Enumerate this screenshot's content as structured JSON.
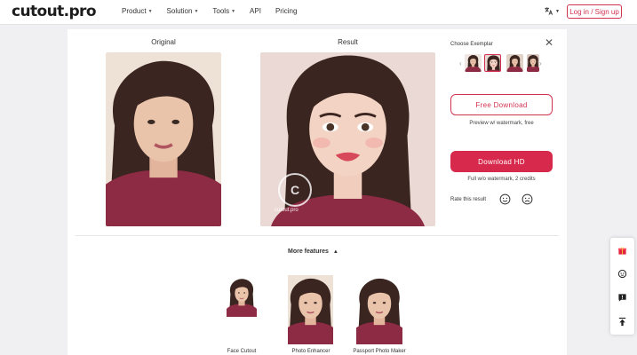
{
  "header": {
    "logo": "cutout.pro",
    "nav": [
      {
        "label": "Product",
        "dropdown": true
      },
      {
        "label": "Solution",
        "dropdown": true
      },
      {
        "label": "Tools",
        "dropdown": true
      },
      {
        "label": "API",
        "dropdown": false
      },
      {
        "label": "Pricing",
        "dropdown": false
      }
    ],
    "login_label": "Log in / Sign up",
    "language_icon": "translate-icon"
  },
  "main": {
    "original_label": "Original",
    "result_label": "Result",
    "watermark_text": "cutout.pro"
  },
  "sidebar": {
    "exemplar_label": "Choose Exemplar",
    "free_download_label": "Free Download",
    "free_download_note": "Preview w/ watermark, free",
    "hd_download_label": "Download HD",
    "hd_download_note": "Full w/o watermark, 2 credits",
    "rate_label": "Rate this result"
  },
  "features": {
    "more_label": "More features",
    "items": [
      {
        "label": "Face Cutout"
      },
      {
        "label": "Photo Enhancer"
      },
      {
        "label": "Passport Photo Maker"
      }
    ]
  },
  "colors": {
    "accent": "#d7294b",
    "shirt": "#8e2b44",
    "hair": "#3a2520",
    "skin": "#e9c2aa"
  },
  "side_tools": [
    "gift-icon",
    "chat-bot-icon",
    "feedback-icon",
    "back-to-top-icon"
  ]
}
